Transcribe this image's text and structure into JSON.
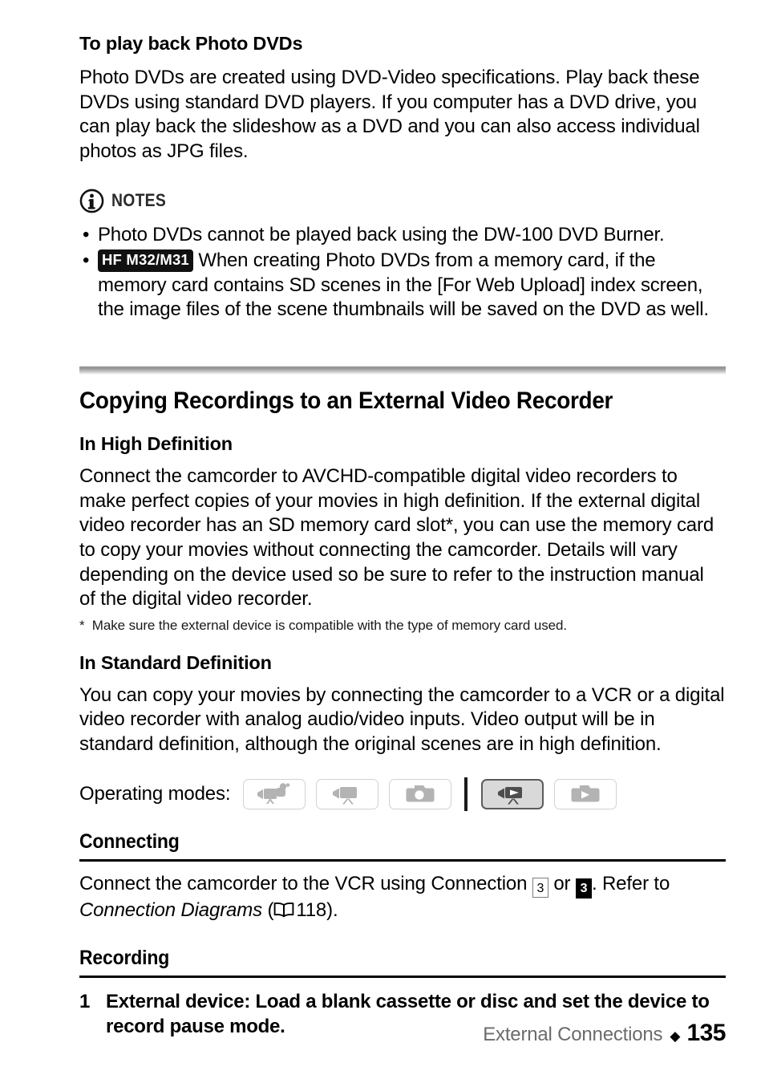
{
  "page": {
    "number": "135",
    "section_footer": "External Connections",
    "footer_separator": "◆"
  },
  "photo_dvd": {
    "heading": "To play back Photo DVDs",
    "paragraph": "Photo DVDs are created using DVD-Video specifications. Play back these DVDs using standard DVD players. If you computer has a DVD drive, you can play back the slideshow as a DVD and you can also access individual photos as JPG files."
  },
  "notes": {
    "icon": "info-circle-icon",
    "label": "NOTES",
    "items": [
      {
        "bullet": "•",
        "badge": null,
        "text": "Photo DVDs cannot be played back using the DW-100 DVD Burner."
      },
      {
        "bullet": "•",
        "badge": "HF M32/M31",
        "text": "When creating Photo DVDs from a memory card, if the memory card contains SD scenes in the [For Web Upload] index screen, the image files of the scene thumbnails will be saved on the DVD as well."
      }
    ]
  },
  "section": {
    "title": "Copying Recordings to an External Video Recorder",
    "high_definition": {
      "heading": "In High Definition",
      "paragraph": "Connect the camcorder to AVCHD-compatible digital video recorders to make perfect copies of your movies in high definition. If the external digital video recorder has an SD memory card slot*, you can use the memory card to copy your movies without connecting the camcorder. Details will vary depending on the device used so be sure to refer to the instruction manual of the digital video recorder.",
      "footnote_marker": "*",
      "footnote": "Make sure the external device is compatible with the type of memory card used."
    },
    "standard_definition": {
      "heading": "In Standard Definition",
      "paragraph": "You can copy your movies by connecting the camcorder to a VCR or a digital video recorder with analog audio/video inputs. Video output will be in standard definition, although the original scenes are in high definition."
    }
  },
  "operating_modes": {
    "label": "Operating modes:",
    "buttons": [
      {
        "name": "mode-auto-record-movie",
        "icon": "camcorder-auto-icon",
        "active": false
      },
      {
        "name": "mode-record-movie",
        "icon": "camcorder-icon",
        "active": false
      },
      {
        "name": "mode-record-photo",
        "icon": "still-camera-icon",
        "active": false
      },
      {
        "name": "mode-playback-movie",
        "icon": "camcorder-play-icon",
        "active": true
      },
      {
        "name": "mode-playback-photo",
        "icon": "camera-play-icon",
        "active": false
      }
    ]
  },
  "connecting": {
    "heading": "Connecting",
    "text_before": "Connect the camcorder to the VCR using Connection",
    "badge_outline": "3",
    "conjunction": "or",
    "badge_filled": "3",
    "text_after": ". Refer to",
    "reference_title": "Connection Diagrams",
    "open_paren": "(",
    "book_icon": "book-icon",
    "page_ref": "118).",
    "page_number": "118"
  },
  "recording": {
    "heading": "Recording",
    "steps": [
      {
        "number": "1",
        "text": "External device: Load a blank cassette or disc and set the device to record pause mode."
      }
    ]
  },
  "colors": {
    "text": "#000000",
    "muted": "#6b6b6b",
    "badge_bg": "#111111",
    "mode_active_bg": "#d9d9d9",
    "mode_icon": "#b3b3b3",
    "mode_icon_active": "#4d4d4d"
  }
}
